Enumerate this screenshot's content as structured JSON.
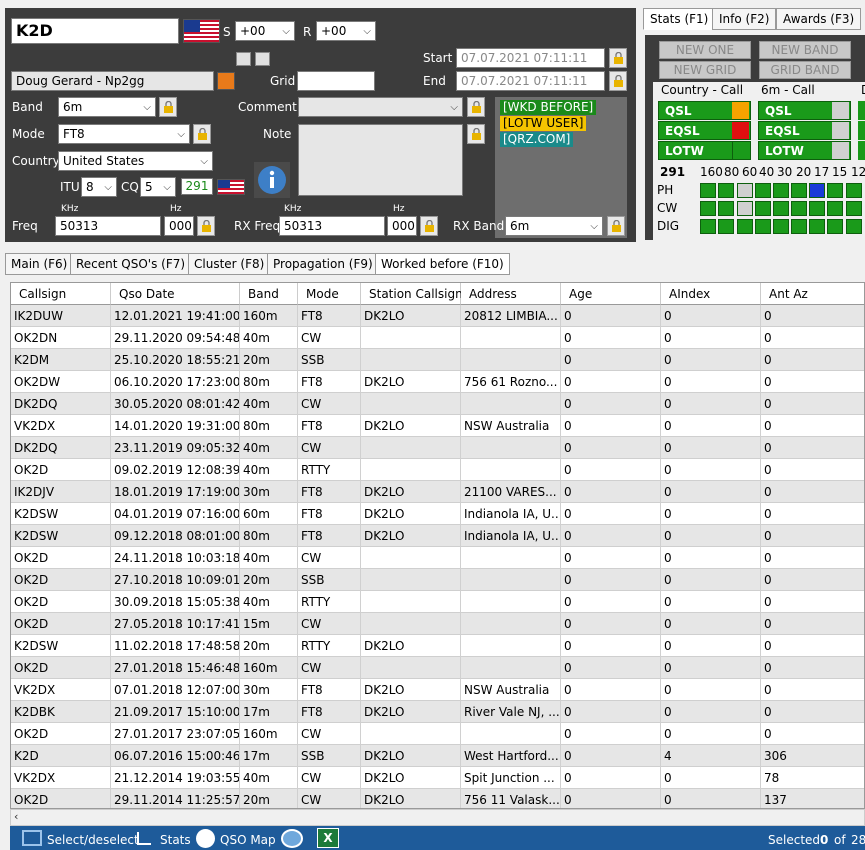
{
  "entry": {
    "callsign": "K2D",
    "s_label": "S",
    "s_value": "+00",
    "r_label": "R",
    "r_value": "+00",
    "name": "Doug Gerard - Np2gg",
    "grid_label": "Grid",
    "grid_value": "",
    "start_label": "Start",
    "start_value": "07.07.2021 07:11:11",
    "end_label": "End",
    "end_value": "07.07.2021 07:11:11",
    "band_label": "Band",
    "band_value": "6m",
    "mode_label": "Mode",
    "mode_value": "FT8",
    "country_label": "Country",
    "country_value": "United States",
    "comment_label": "Comment",
    "comment_value": "",
    "note_label": "Note",
    "itu_label": "ITU",
    "itu_value": "8",
    "cq_label": "CQ",
    "cq_value": "5",
    "dxcc_num": "291",
    "tags": [
      "[WKD BEFORE]",
      "[LOTW USER]",
      "[QRZ.COM]"
    ],
    "tag_colors": [
      "#1a8a1a",
      "#f5c400",
      "#1a8a8a"
    ],
    "khz_label": "KHz",
    "hz_label": "Hz",
    "freq_label": "Freq",
    "freq_khz": "50313",
    "freq_hz": "000",
    "rxfreq_label": "RX Freq",
    "rxfreq_khz": "50313",
    "rxfreq_hz": "000",
    "rxband_label": "RX Band",
    "rxband_value": "6m"
  },
  "right_tabs": [
    "Stats (F1)",
    "Info (F2)",
    "Awards (F3)"
  ],
  "stats": {
    "new_one": "NEW ONE",
    "new_band": "NEW BAND",
    "new_grid": "NEW GRID",
    "grid_band": "GRID BAND",
    "country_call": "Country - Call",
    "band_call": "6m - Call",
    "third_col": "D",
    "qsl": "QSL",
    "eqsl": "EQSL",
    "lotw": "LOTW",
    "dxcc": "291",
    "bands": [
      "160",
      "80",
      "60",
      "40",
      "30",
      "20",
      "17",
      "15",
      "12"
    ],
    "mode_rows": [
      "PH",
      "CW",
      "DIG"
    ]
  },
  "bottom_tabs": [
    "Main (F6)",
    "Recent QSO's (F7)",
    "Cluster (F8)",
    "Propagation (F9)",
    "Worked before (F10)"
  ],
  "grid": {
    "columns": [
      "Callsign",
      "Qso Date",
      "Band",
      "Mode",
      "Station Callsign",
      "Address",
      "Age",
      "AIndex",
      "Ant Az"
    ],
    "rows": [
      [
        "IK2DUW",
        "12.01.2021 19:41:00",
        "160m",
        "FT8",
        "DK2LO",
        "20812 LIMBIA...",
        "0",
        "0",
        "0"
      ],
      [
        "OK2DN",
        "29.11.2020 09:54:48",
        "40m",
        "CW",
        "",
        "",
        "0",
        "0",
        "0"
      ],
      [
        "K2DM",
        "25.10.2020 18:55:21",
        "20m",
        "SSB",
        "",
        "",
        "0",
        "0",
        "0"
      ],
      [
        "OK2DW",
        "06.10.2020 17:23:00",
        "80m",
        "FT8",
        "DK2LO",
        "756 61 Rozno...",
        "0",
        "0",
        "0"
      ],
      [
        "DK2DQ",
        "30.05.2020 08:01:42",
        "40m",
        "CW",
        "",
        "",
        "0",
        "0",
        "0"
      ],
      [
        "VK2DX",
        "14.01.2020 19:31:00",
        "80m",
        "FT8",
        "DK2LO",
        "NSW Australia",
        "0",
        "0",
        "0"
      ],
      [
        "DK2DQ",
        "23.11.2019 09:05:32",
        "40m",
        "CW",
        "",
        "",
        "0",
        "0",
        "0"
      ],
      [
        "OK2D",
        "09.02.2019 12:08:39",
        "40m",
        "RTTY",
        "",
        "",
        "0",
        "0",
        "0"
      ],
      [
        "IK2DJV",
        "18.01.2019 17:19:00",
        "30m",
        "FT8",
        "DK2LO",
        "21100 VARES...",
        "0",
        "0",
        "0"
      ],
      [
        "K2DSW",
        "04.01.2019 07:16:00",
        "60m",
        "FT8",
        "DK2LO",
        "Indianola IA, U...",
        "0",
        "0",
        "0"
      ],
      [
        "K2DSW",
        "09.12.2018 08:01:00",
        "80m",
        "FT8",
        "DK2LO",
        "Indianola IA, U...",
        "0",
        "0",
        "0"
      ],
      [
        "OK2D",
        "24.11.2018 10:03:18",
        "40m",
        "CW",
        "",
        "",
        "0",
        "0",
        "0"
      ],
      [
        "OK2D",
        "27.10.2018 10:09:01",
        "20m",
        "SSB",
        "",
        "",
        "0",
        "0",
        "0"
      ],
      [
        "OK2D",
        "30.09.2018 15:05:38",
        "40m",
        "RTTY",
        "",
        "",
        "0",
        "0",
        "0"
      ],
      [
        "OK2D",
        "27.05.2018 10:17:41",
        "15m",
        "CW",
        "",
        "",
        "0",
        "0",
        "0"
      ],
      [
        "K2DSW",
        "11.02.2018 17:48:58",
        "20m",
        "RTTY",
        "DK2LO",
        "",
        "0",
        "0",
        "0"
      ],
      [
        "OK2D",
        "27.01.2018 15:46:48",
        "160m",
        "CW",
        "",
        "",
        "0",
        "0",
        "0"
      ],
      [
        "VK2DX",
        "07.01.2018 12:07:00",
        "30m",
        "FT8",
        "DK2LO",
        "NSW Australia",
        "0",
        "0",
        "0"
      ],
      [
        "K2DBK",
        "21.09.2017 15:10:00",
        "17m",
        "FT8",
        "DK2LO",
        "River Vale NJ, ...",
        "0",
        "0",
        "0"
      ],
      [
        "OK2D",
        "27.01.2017 23:07:05",
        "160m",
        "CW",
        "",
        "",
        "0",
        "0",
        "0"
      ],
      [
        "K2D",
        "06.07.2016 15:00:46",
        "17m",
        "SSB",
        "DK2LO",
        "West Hartford...",
        "0",
        "4",
        "306"
      ],
      [
        "VK2DX",
        "21.12.2014 19:03:55",
        "40m",
        "CW",
        "DK2LO",
        "Spit Junction ...",
        "0",
        "0",
        "78"
      ],
      [
        "OK2D",
        "29.11.2014 11:25:57",
        "20m",
        "CW",
        "DK2LO",
        "756 11 Valask...",
        "0",
        "0",
        "137"
      ]
    ]
  },
  "status": {
    "select_label": "Select/deselect",
    "stats_label": "Stats",
    "map_label": "QSO Map",
    "selected_label": "Selected",
    "selected_count": "0",
    "of_label": "of",
    "total": "28"
  }
}
